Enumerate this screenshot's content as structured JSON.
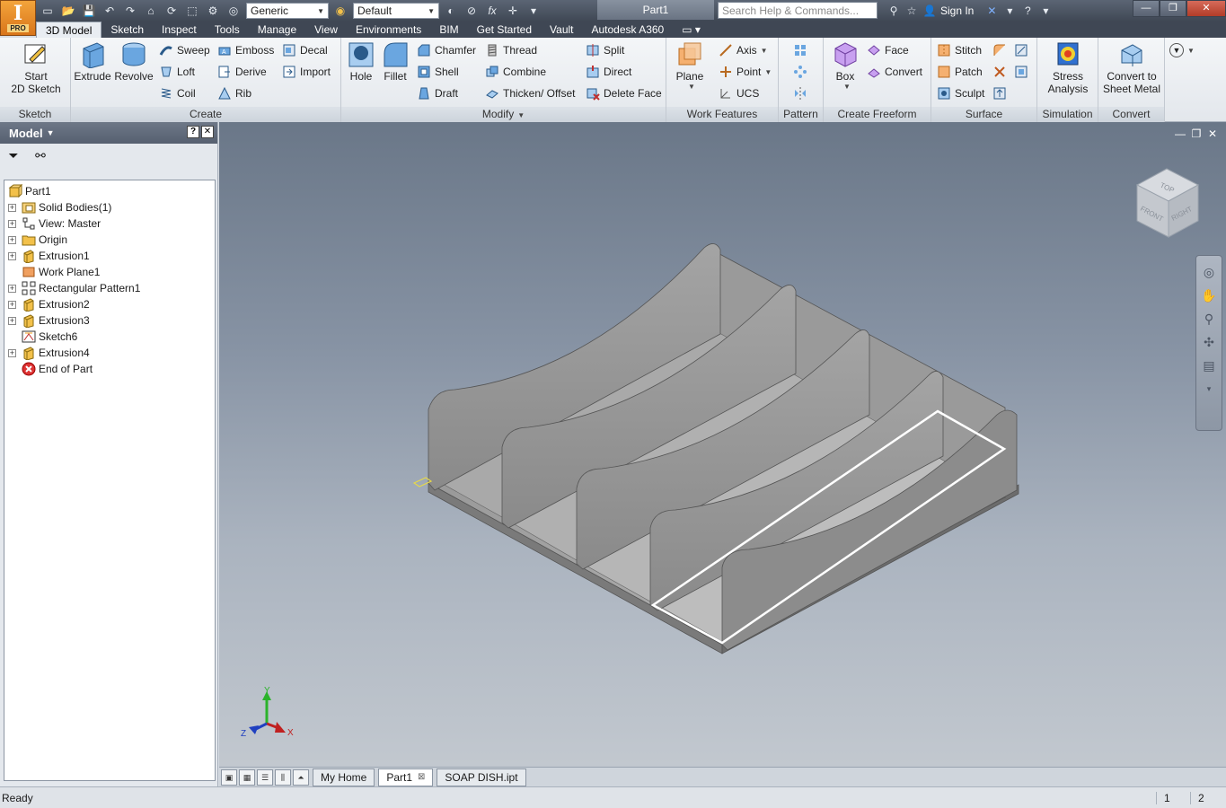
{
  "app": {
    "badge": "PRO",
    "document_title": "Part1",
    "search_placeholder": "Search Help & Commands...",
    "sign_in": "Sign In"
  },
  "quick_access": {
    "material": "Generic",
    "appearance": "Default"
  },
  "ribbon_tabs": [
    "3D Model",
    "Sketch",
    "Inspect",
    "Tools",
    "Manage",
    "View",
    "Environments",
    "BIM",
    "Get Started",
    "Vault",
    "Autodesk A360"
  ],
  "ribbon": {
    "sketch": {
      "label": "Sketch",
      "start_2d_sketch": [
        "Start",
        "2D Sketch"
      ]
    },
    "create": {
      "label": "Create",
      "extrude": "Extrude",
      "revolve": "Revolve",
      "sweep": "Sweep",
      "emboss": "Emboss",
      "decal": "Decal",
      "loft": "Loft",
      "derive": "Derive",
      "import": "Import",
      "coil": "Coil",
      "rib": "Rib"
    },
    "modify": {
      "label": "Modify",
      "hole": "Hole",
      "fillet": "Fillet",
      "chamfer": "Chamfer",
      "thread": "Thread",
      "split": "Split",
      "shell": "Shell",
      "combine": "Combine",
      "direct": "Direct",
      "draft": "Draft",
      "thicken_offset": "Thicken/ Offset",
      "delete_face": "Delete Face"
    },
    "work_features": {
      "label": "Work Features",
      "plane": "Plane",
      "axis": "Axis",
      "point": "Point",
      "ucs": "UCS"
    },
    "pattern": {
      "label": "Pattern"
    },
    "create_freeform": {
      "label": "Create Freeform",
      "box": "Box",
      "face": "Face",
      "convert": "Convert"
    },
    "surface": {
      "label": "Surface",
      "stitch": "Stitch",
      "patch": "Patch",
      "sculpt": "Sculpt"
    },
    "simulation": {
      "label": "Simulation",
      "stress_analysis": [
        "Stress",
        "Analysis"
      ]
    },
    "convert": {
      "label": "Convert",
      "convert_to_sheet_metal": [
        "Convert to",
        "Sheet Metal"
      ]
    }
  },
  "browser": {
    "title": "Model",
    "tree": [
      {
        "label": "Part1",
        "icon": "part-icon",
        "expandable": false,
        "root": true
      },
      {
        "label": "Solid Bodies(1)",
        "icon": "solid-bodies-icon",
        "expandable": true
      },
      {
        "label": "View: Master",
        "icon": "view-icon",
        "expandable": true
      },
      {
        "label": "Origin",
        "icon": "folder-icon",
        "expandable": true
      },
      {
        "label": "Extrusion1",
        "icon": "extrusion-icon",
        "expandable": true
      },
      {
        "label": "Work Plane1",
        "icon": "work-plane-icon",
        "expandable": false
      },
      {
        "label": "Rectangular Pattern1",
        "icon": "rect-pattern-icon",
        "expandable": true
      },
      {
        "label": "Extrusion2",
        "icon": "extrusion-icon",
        "expandable": true
      },
      {
        "label": "Extrusion3",
        "icon": "extrusion-icon",
        "expandable": true
      },
      {
        "label": "Sketch6",
        "icon": "sketch-icon",
        "expandable": false
      },
      {
        "label": "Extrusion4",
        "icon": "extrusion-icon",
        "expandable": true
      },
      {
        "label": "End of Part",
        "icon": "end-of-part-icon",
        "expandable": false
      }
    ]
  },
  "viewcube": {
    "top": "TOP",
    "front": "FRONT",
    "right": "RIGHT"
  },
  "triad": {
    "x": "X",
    "y": "Y",
    "z": "Z"
  },
  "document_tabs": [
    {
      "label": "My Home",
      "active": false,
      "closable": false
    },
    {
      "label": "Part1",
      "active": true,
      "closable": true
    },
    {
      "label": "SOAP DISH.ipt",
      "active": false,
      "closable": false
    }
  ],
  "status": {
    "text": "Ready",
    "count1": "1",
    "count2": "2"
  }
}
